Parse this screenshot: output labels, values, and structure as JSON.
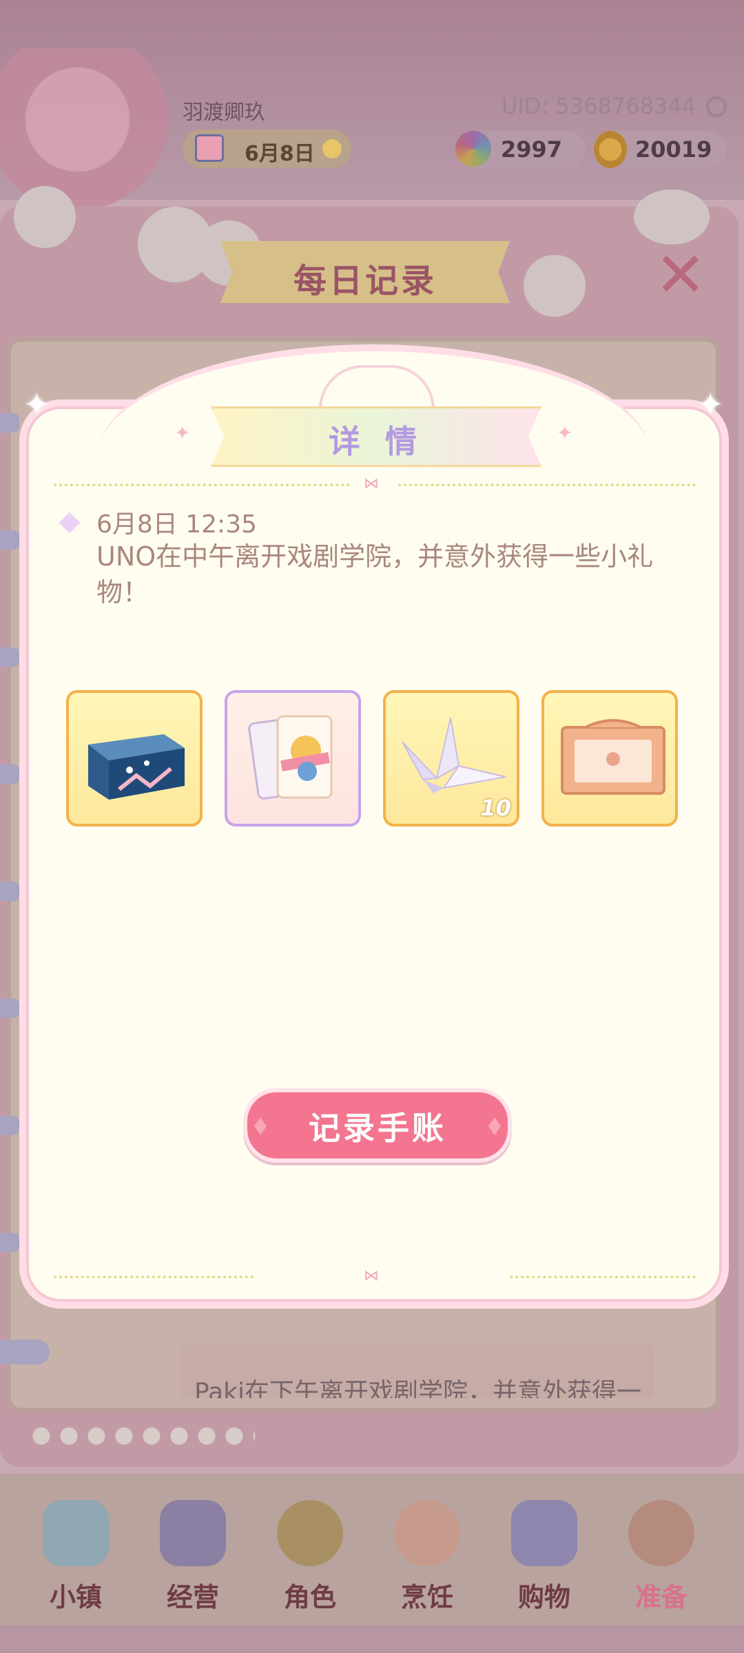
{
  "hud": {
    "player_name": "羽渡卿玖",
    "uid": "UID: 5368768344",
    "date": "6月8日",
    "gems": "2997",
    "coins": "20019"
  },
  "background_panel": {
    "title": "每日记录",
    "close_symbol": "✕",
    "partial_entry_text": "Paki在下午离开戏剧学院，并意外获得一"
  },
  "modal": {
    "title": "详 情",
    "entry": {
      "time": "6月8日 12:35",
      "text": "UNO在中午离开戏剧学院，并意外获得一些小礼物！"
    },
    "items": [
      {
        "icon": "blue-gift-box-icon",
        "count": ""
      },
      {
        "icon": "playing-cards-icon",
        "count": ""
      },
      {
        "icon": "paper-crane-icon",
        "count": "10"
      },
      {
        "icon": "stage-frame-icon",
        "count": ""
      }
    ],
    "button_label": "记录手账"
  },
  "nav": {
    "items": [
      {
        "label": "小镇",
        "icon": "map-icon"
      },
      {
        "label": "经营",
        "icon": "shop-bag-icon"
      },
      {
        "label": "角色",
        "icon": "character-icon"
      },
      {
        "label": "烹饪",
        "icon": "sandwich-icon"
      },
      {
        "label": "购物",
        "icon": "shopping-bag-icon"
      },
      {
        "label": "准备",
        "icon": "basket-icon"
      }
    ],
    "active": "准备"
  }
}
